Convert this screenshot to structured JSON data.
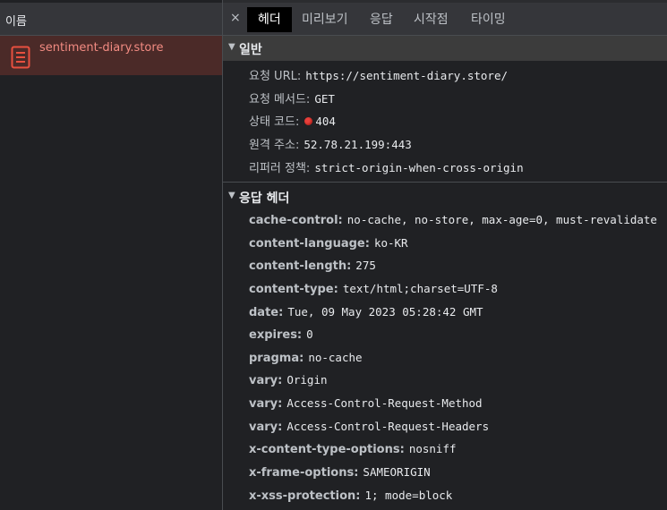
{
  "left_panel": {
    "header": "이름",
    "file_name": "sentiment-diary.store"
  },
  "tabs": {
    "close": "×",
    "items": [
      "헤더",
      "미리보기",
      "응답",
      "시작점",
      "타이밍"
    ]
  },
  "general": {
    "title": "일반",
    "request_url_label": "요청 URL:",
    "request_url": "https://sentiment-diary.store/",
    "request_method_label": "요청 메서드:",
    "request_method": "GET",
    "status_label": "상태 코드:",
    "status_code": "404",
    "remote_label": "원격 주소:",
    "remote_address": "52.78.21.199:443",
    "referrer_label": "리퍼러 정책:",
    "referrer_policy": "strict-origin-when-cross-origin"
  },
  "response_headers": {
    "title": "응답 헤더",
    "items": [
      {
        "key": "cache-control:",
        "value": "no-cache, no-store, max-age=0, must-revalidate"
      },
      {
        "key": "content-language:",
        "value": "ko-KR"
      },
      {
        "key": "content-length:",
        "value": "275"
      },
      {
        "key": "content-type:",
        "value": "text/html;charset=UTF-8"
      },
      {
        "key": "date:",
        "value": "Tue, 09 May 2023 05:28:42 GMT"
      },
      {
        "key": "expires:",
        "value": "0"
      },
      {
        "key": "pragma:",
        "value": "no-cache"
      },
      {
        "key": "vary:",
        "value": "Origin"
      },
      {
        "key": "vary:",
        "value": "Access-Control-Request-Method"
      },
      {
        "key": "vary:",
        "value": "Access-Control-Request-Headers"
      },
      {
        "key": "x-content-type-options:",
        "value": "nosniff"
      },
      {
        "key": "x-frame-options:",
        "value": "SAMEORIGIN"
      },
      {
        "key": "x-xss-protection:",
        "value": "1; mode=block"
      }
    ]
  },
  "colors": {
    "status_error": "#e8403b",
    "selected_file": "#f28b82"
  }
}
